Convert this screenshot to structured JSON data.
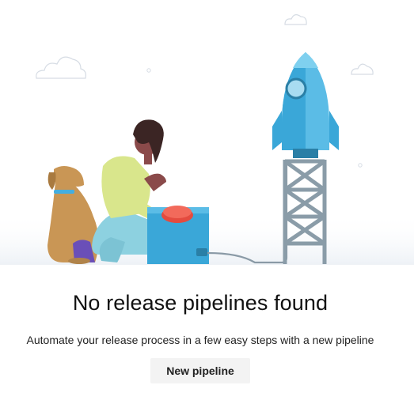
{
  "empty_state": {
    "title": "No release pipelines found",
    "description": "Automate your release process in a few easy steps with a new pipeline",
    "new_pipeline_label": "New pipeline"
  },
  "illustration": {
    "elements": [
      "cloud-icon",
      "cloud-icon",
      "cloud-icon",
      "dog-icon",
      "person-icon",
      "launch-button-box-icon",
      "rocket-icon",
      "launch-tower-icon",
      "cable-icon"
    ]
  }
}
